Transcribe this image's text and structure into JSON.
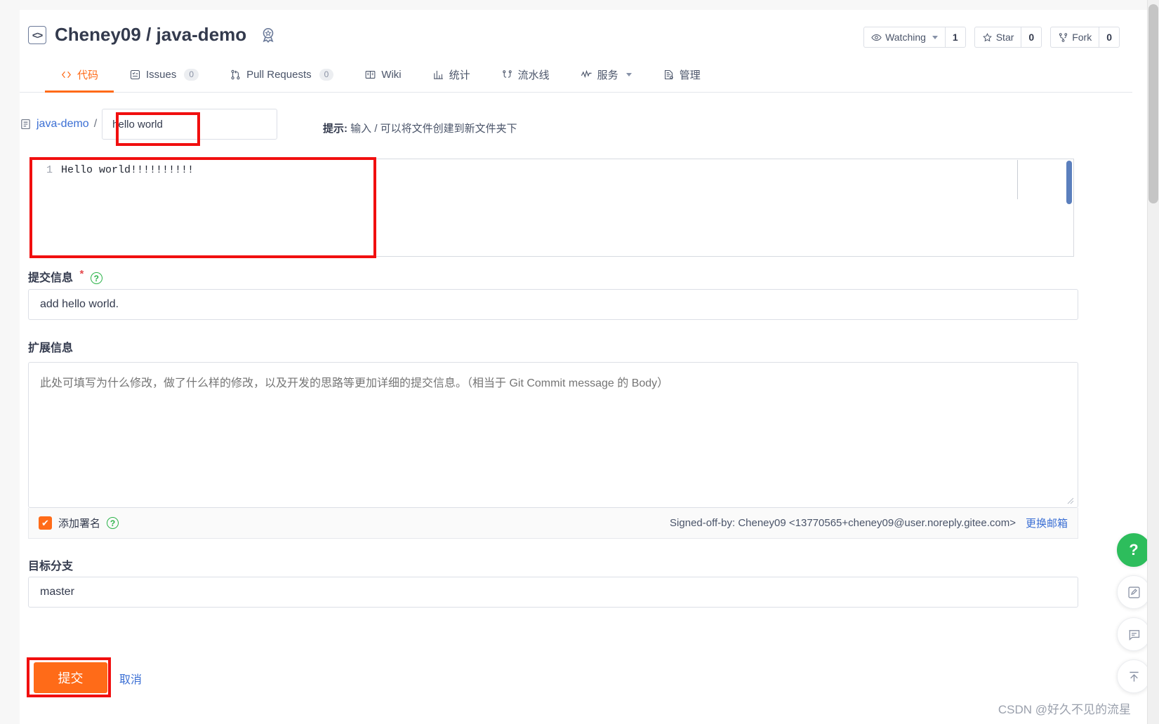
{
  "header": {
    "repo_icon": "code-brackets-icon",
    "owner": "Cheney09",
    "separator": "/",
    "repo": "java-demo",
    "badge_icon": "award-badge-icon",
    "watch_label": "Watching",
    "watch_count": "1",
    "star_label": "Star",
    "star_count": "0",
    "fork_label": "Fork",
    "fork_count": "0"
  },
  "nav": {
    "items": [
      {
        "label": "代码",
        "icon": "code-icon",
        "count": null,
        "active": true
      },
      {
        "label": "Issues",
        "icon": "issue-list-icon",
        "count": "0",
        "active": false
      },
      {
        "label": "Pull Requests",
        "icon": "pull-request-icon",
        "count": "0",
        "active": false
      },
      {
        "label": "Wiki",
        "icon": "book-icon",
        "count": null,
        "active": false
      },
      {
        "label": "统计",
        "icon": "chart-bar-icon",
        "count": null,
        "active": false
      },
      {
        "label": "流水线",
        "icon": "pipeline-icon",
        "count": null,
        "active": false
      },
      {
        "label": "服务",
        "icon": "activity-icon",
        "count": null,
        "active": false,
        "dropdown": true
      },
      {
        "label": "管理",
        "icon": "settings-doc-icon",
        "count": null,
        "active": false
      }
    ]
  },
  "path": {
    "repo_link": "java-demo",
    "slash": "/",
    "filename_value": "hello world",
    "filename_placeholder": "",
    "hint_label": "提示:",
    "hint_text": " 输入 / 可以将文件创建到新文件夹下"
  },
  "editor": {
    "line_number": "1",
    "line_text": "Hello world!!!!!!!!!!"
  },
  "commit": {
    "label": "提交信息",
    "required_mark": "*",
    "help_icon": "question-circle-icon",
    "value": "add hello world.",
    "placeholder": ""
  },
  "extended": {
    "label": "扩展信息",
    "placeholder": "此处可填写为什么修改，做了什么样的修改，以及开发的思路等更加详细的提交信息。（相当于 Git Commit message 的 Body）",
    "value": ""
  },
  "signoff": {
    "checked": true,
    "checkbox_glyph": "✔",
    "label": "添加署名",
    "help_icon": "question-circle-icon",
    "text": "Signed-off-by: Cheney09 <13770565+cheney09@user.noreply.gitee.com>",
    "change_email_link": "更换邮箱"
  },
  "branch": {
    "label": "目标分支",
    "value": "master"
  },
  "actions": {
    "submit_label": "提交",
    "cancel_label": "取消"
  },
  "rail": {
    "items": [
      {
        "icon": "help-question-icon",
        "glyph": "?",
        "style": "green"
      },
      {
        "icon": "edit-pencil-icon",
        "glyph": "✎",
        "style": "plain"
      },
      {
        "icon": "comment-bubble-icon",
        "glyph": "💬",
        "style": "plain"
      },
      {
        "icon": "scroll-to-top-icon",
        "glyph": "↑",
        "style": "plain"
      }
    ]
  },
  "watermark": {
    "text": "CSDN @好久不见的流星"
  },
  "colors": {
    "accent": "#ff6b18",
    "link": "#3b6fd4",
    "annotation": "#f10f0f",
    "green": "#2cb34a"
  }
}
